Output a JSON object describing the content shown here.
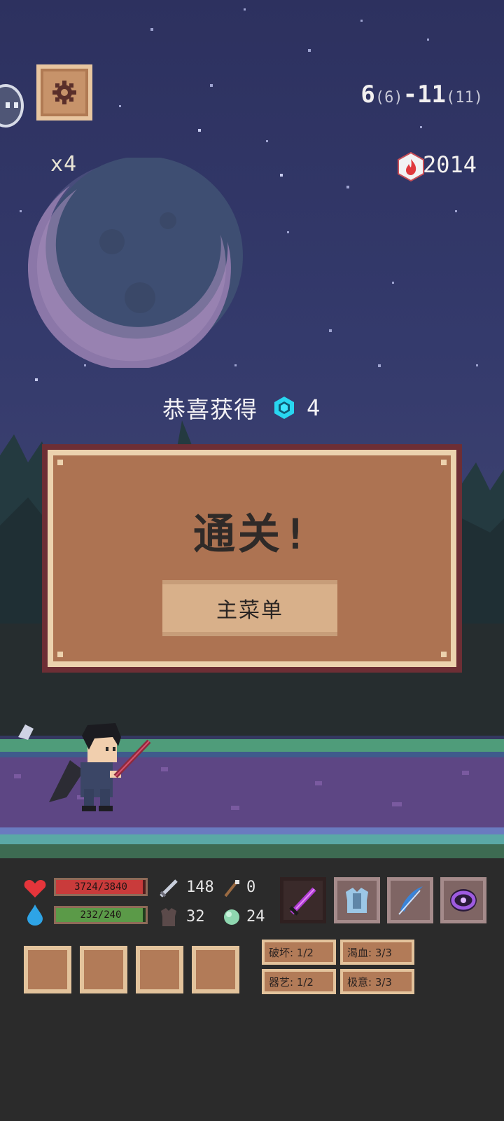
{
  "top_hud": {
    "settings_icon": "gear-icon",
    "speed": "x4",
    "stage_main_a": "6",
    "stage_sub_a": "(6)",
    "stage_sep": "-",
    "stage_main_b": "11",
    "stage_sub_b": "(11)",
    "score_icon": "fire-icon",
    "score": "2014"
  },
  "reward": {
    "text": "恭喜获得",
    "icon": "gem-icon",
    "count": "4"
  },
  "dialog": {
    "title": "通关!",
    "main_menu_button": "主菜单"
  },
  "player": {
    "hp": {
      "icon": "heart-icon",
      "label": "3724/3840",
      "current": 3724,
      "max": 3840
    },
    "mp": {
      "icon": "water-drop-icon",
      "label": "232/240",
      "current": 232,
      "max": 240
    },
    "stats": [
      {
        "icon": "sword-icon",
        "value": "148"
      },
      {
        "icon": "wand-icon",
        "value": "0"
      },
      {
        "icon": "armor-icon",
        "value": "32"
      },
      {
        "icon": "orb-icon",
        "value": "24"
      }
    ],
    "equipment": [
      {
        "name": "sword-equip",
        "icon": "purple-sword-icon"
      },
      {
        "name": "armor-equip",
        "icon": "chest-armor-icon"
      },
      {
        "name": "quill-equip",
        "icon": "feather-icon"
      },
      {
        "name": "ring-equip",
        "icon": "purple-ring-icon"
      }
    ],
    "buffs": [
      {
        "label": "破坏: 1/2"
      },
      {
        "label": "渴血: 3/3"
      },
      {
        "label": "器艺: 1/2"
      },
      {
        "label": "极意: 3/3"
      }
    ]
  },
  "colors": {
    "sky": "#343a6c",
    "dialog_border": "#6d2e35",
    "dialog_panel": "#ad7352",
    "hp": "#c93b3b",
    "mp": "#5b9a48",
    "gem": "#28d6f0"
  }
}
